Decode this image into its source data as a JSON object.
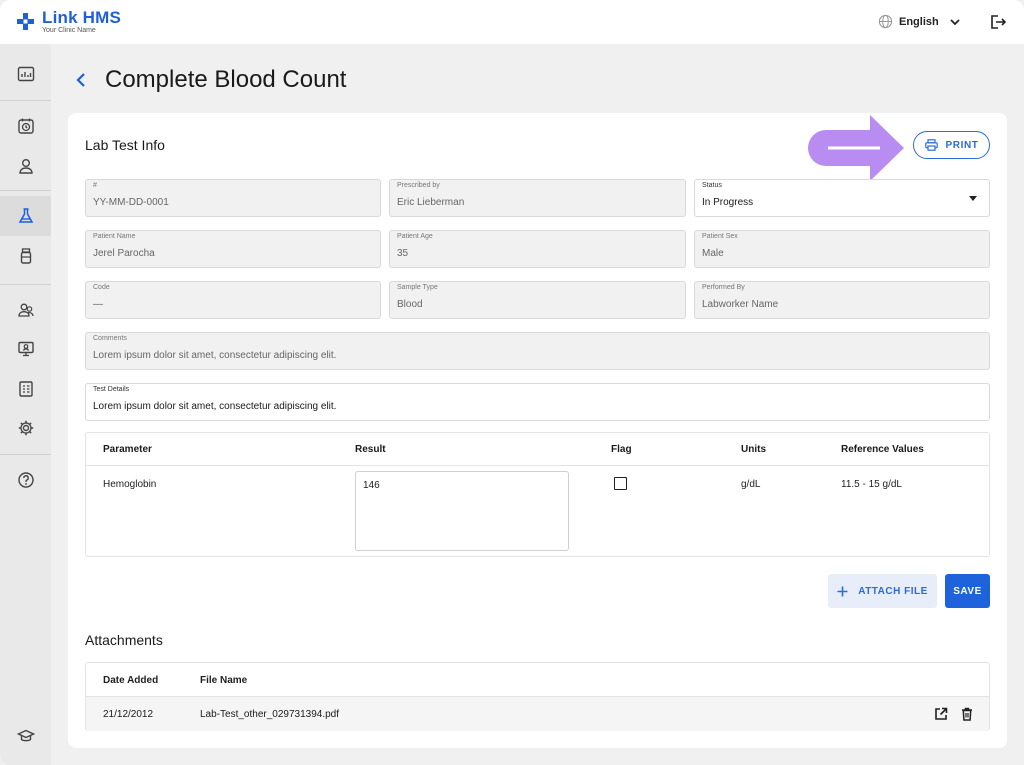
{
  "app": {
    "logo_title": "Link HMS",
    "logo_subtitle": "Your Clinic Name",
    "language": "English",
    "brand_color": "#1f5fd9"
  },
  "sidebar": {
    "items": [
      {
        "name": "dashboard",
        "icon": "chart-icon"
      },
      {
        "name": "appointments",
        "icon": "clock-calendar-icon"
      },
      {
        "name": "patients",
        "icon": "person-icon"
      },
      {
        "name": "labs",
        "icon": "flask-icon",
        "active": true
      },
      {
        "name": "medications",
        "icon": "bottle-icon"
      },
      {
        "name": "staff",
        "icon": "users-icon"
      },
      {
        "name": "monitor",
        "icon": "monitor-icon"
      },
      {
        "name": "reports",
        "icon": "document-icon"
      },
      {
        "name": "settings",
        "icon": "gear-icon"
      },
      {
        "name": "help",
        "icon": "help-icon"
      },
      {
        "name": "learning",
        "icon": "graduation-cap-icon"
      }
    ]
  },
  "page": {
    "title": "Complete Blood Count"
  },
  "lab_info": {
    "section_title": "Lab Test Info",
    "print_label": "PRINT",
    "fields": {
      "number": {
        "label": "#",
        "value": "YY-MM-DD-0001"
      },
      "prescribed_by": {
        "label": "Prescribed by",
        "value": "Eric Lieberman"
      },
      "status": {
        "label": "Status",
        "value": "In Progress"
      },
      "patient_name": {
        "label": "Patient Name",
        "value": "Jerel Parocha"
      },
      "patient_age": {
        "label": "Patient Age",
        "value": "35"
      },
      "patient_sex": {
        "label": "Patient Sex",
        "value": "Male"
      },
      "code": {
        "label": "Code",
        "value": "—"
      },
      "sample_type": {
        "label": "Sample Type",
        "value": "Blood"
      },
      "performed_by": {
        "label": "Performed By",
        "value": "Labworker Name"
      },
      "comments": {
        "label": "Comments",
        "value": "Lorem ipsum dolor sit amet, consectetur adipiscing elit."
      },
      "test_details": {
        "label": "Test Details",
        "value": "Lorem ipsum dolor sit amet, consectetur adipiscing elit."
      }
    }
  },
  "results": {
    "headers": [
      "Parameter",
      "Result",
      "Flag",
      "Units",
      "Reference Values"
    ],
    "rows": [
      {
        "parameter": "Hemoglobin",
        "result": "146",
        "flag": false,
        "units": "g/dL",
        "reference": "11.5 - 15 g/dL"
      }
    ]
  },
  "actions": {
    "attach_file_label": "ATTACH FILE",
    "save_label": "SAVE"
  },
  "attachments": {
    "section_title": "Attachments",
    "headers": [
      "Date Added",
      "File Name"
    ],
    "rows": [
      {
        "date_added": "21/12/2012",
        "file_name": "Lab-Test_other_029731394.pdf"
      }
    ]
  }
}
